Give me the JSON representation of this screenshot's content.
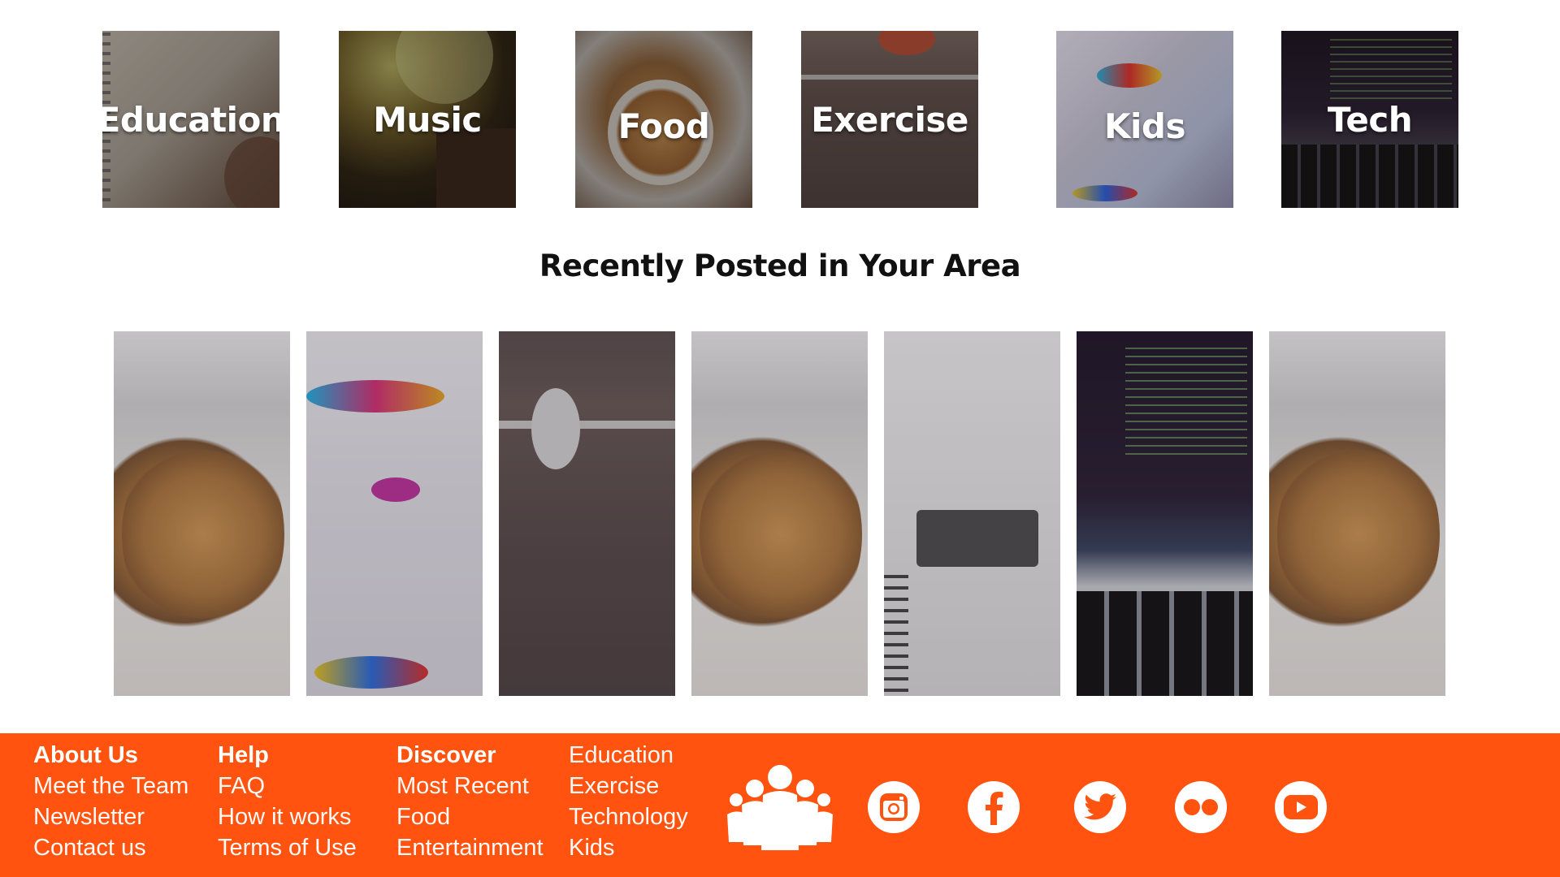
{
  "categories": [
    {
      "label": "Education"
    },
    {
      "label": "Music"
    },
    {
      "label": "Food"
    },
    {
      "label": "Exercise"
    },
    {
      "label": "Kids"
    },
    {
      "label": "Tech"
    }
  ],
  "recent": {
    "title": "Recently Posted in Your Area",
    "posts": [
      {
        "image": "muffins"
      },
      {
        "image": "letters-art"
      },
      {
        "image": "runner-legs"
      },
      {
        "image": "muffins"
      },
      {
        "image": "notebook"
      },
      {
        "image": "laptop-code"
      },
      {
        "image": "muffins"
      }
    ]
  },
  "footer": {
    "background": "#ff530f",
    "columns": [
      {
        "heading": "About Us",
        "links": [
          "Meet the Team",
          "Newsletter",
          "Contact us"
        ]
      },
      {
        "heading": "Help",
        "links": [
          "FAQ",
          "How it works",
          "Terms of Use"
        ]
      },
      {
        "heading": "Discover",
        "links": [
          "Most Recent",
          "Food",
          "Entertainment"
        ]
      },
      {
        "heading": "",
        "links": [
          "Education",
          "Exercise",
          "Technology",
          "Kids"
        ]
      }
    ],
    "icons": [
      "community-icon",
      "instagram-icon",
      "facebook-icon",
      "twitter-icon",
      "flickr-icon",
      "youtube-icon"
    ]
  }
}
